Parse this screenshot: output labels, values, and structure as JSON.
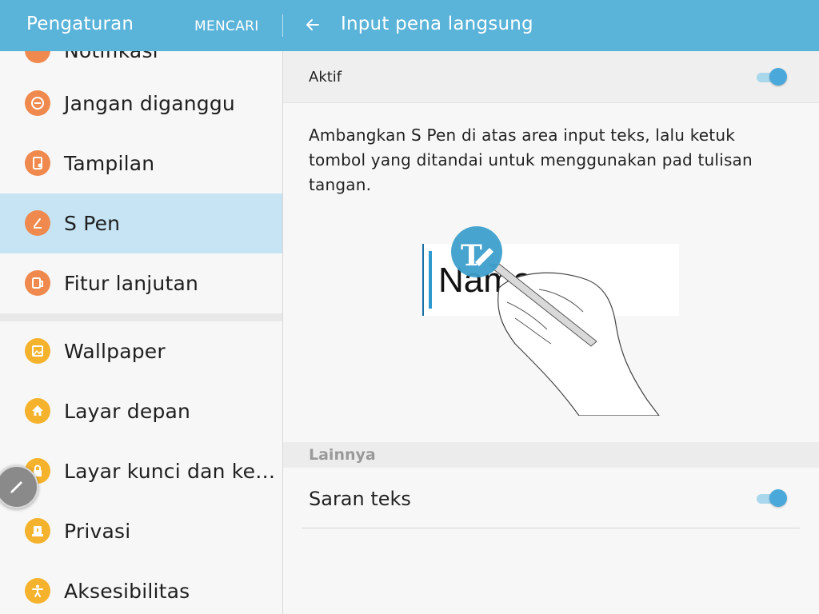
{
  "header": {
    "app_title": "Pengaturan",
    "search_label": "MENCARI",
    "page_title": "Input pena langsung"
  },
  "sidebar": {
    "items": [
      {
        "label": "Notifikasi",
        "icon": "bell-icon",
        "color": "#f0894d"
      },
      {
        "label": "Jangan diganggu",
        "icon": "minus-circle-icon",
        "color": "#f0894d"
      },
      {
        "label": "Tampilan",
        "icon": "display-icon",
        "color": "#f0894d"
      },
      {
        "label": "S Pen",
        "icon": "pen-icon",
        "color": "#f0894d",
        "selected": true
      },
      {
        "label": "Fitur lanjutan",
        "icon": "advanced-features-icon",
        "color": "#f0894d"
      },
      {
        "label": "Wallpaper",
        "icon": "image-icon",
        "color": "#f5b22c"
      },
      {
        "label": "Layar depan",
        "icon": "home-icon",
        "color": "#f5b22c"
      },
      {
        "label": "Layar kunci dan ke…",
        "icon": "lock-icon",
        "color": "#f5b22c"
      },
      {
        "label": "Privasi",
        "icon": "privacy-icon",
        "color": "#f5b22c"
      },
      {
        "label": "Aksesibilitas",
        "icon": "accessibility-icon",
        "color": "#f5b22c"
      }
    ]
  },
  "main": {
    "active_label": "Aktif",
    "active_on": true,
    "description": "Ambangkan S Pen di atas area input teks, lalu ketuk tombol yang ditandai untuk menggunakan pad tulisan tangan.",
    "illustration_text": "Name",
    "section_header": "Lainnya",
    "suggest_label": "Saran teks",
    "suggest_on": true
  },
  "colors": {
    "header_bg": "#5ab3d9",
    "selected_bg": "#c6e4f3",
    "toggle_thumb": "#4aa8db",
    "toggle_track": "#a9d7ec",
    "icon_orange": "#f0894d",
    "icon_yellow": "#f5b22c"
  }
}
